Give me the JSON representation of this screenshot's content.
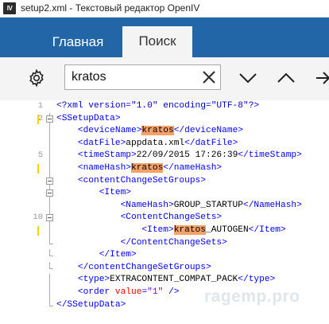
{
  "window": {
    "icon_text": "lV",
    "title": "setup2.xml - Текстовый редактор OpenIV"
  },
  "ribbon": {
    "tabs": [
      {
        "label": "Главная",
        "active": false
      },
      {
        "label": "Поиск",
        "active": true
      }
    ],
    "accent_color": "#2266a8"
  },
  "toolbar": {
    "settings_icon": "gear-icon",
    "search_value": "kratos",
    "clear_icon": "close-icon",
    "find_next_icon": "chevron-down-icon",
    "find_prev_icon": "chevron-up-icon",
    "replace_icon": "arrow-right-icon"
  },
  "editor": {
    "line_number_labels": [
      "1",
      "2",
      "5",
      "10"
    ],
    "lines": [
      {
        "num": "1",
        "fold": "none",
        "mark": false,
        "segments": [
          {
            "text": "<?xml version=\"1.0\" encoding=\"UTF-8\"?>",
            "cls": "t-pi"
          }
        ]
      },
      {
        "num": "2",
        "fold": "box",
        "mark": true,
        "segments": [
          {
            "text": "<SSetupData>",
            "cls": "t-tag"
          }
        ]
      },
      {
        "num": "",
        "fold": "line",
        "mark": false,
        "segments": [
          {
            "text": "    <deviceName>",
            "cls": "t-tag"
          },
          {
            "text": "kratos",
            "cls": "hl"
          },
          {
            "text": "</deviceName>",
            "cls": "t-tag"
          }
        ]
      },
      {
        "num": "",
        "fold": "line",
        "mark": false,
        "segments": [
          {
            "text": "    <datFile>",
            "cls": "t-tag"
          },
          {
            "text": "appdata.xml",
            "cls": "t-txt"
          },
          {
            "text": "</datFile>",
            "cls": "t-tag"
          }
        ]
      },
      {
        "num": "5",
        "fold": "line",
        "mark": false,
        "segments": [
          {
            "text": "    <timeStamp>",
            "cls": "t-tag"
          },
          {
            "text": "22/09/2015 17:26:39",
            "cls": "t-txt"
          },
          {
            "text": "</timeStamp>",
            "cls": "t-tag"
          }
        ]
      },
      {
        "num": "",
        "fold": "line",
        "mark": true,
        "segments": [
          {
            "text": "    <nameHash>",
            "cls": "t-tag"
          },
          {
            "text": "kratos",
            "cls": "hl"
          },
          {
            "text": "</nameHash>",
            "cls": "t-tag"
          }
        ]
      },
      {
        "num": "",
        "fold": "box",
        "mark": false,
        "segments": [
          {
            "text": "    <contentChangeSetGroups>",
            "cls": "t-tag"
          }
        ]
      },
      {
        "num": "",
        "fold": "box",
        "mark": false,
        "segments": [
          {
            "text": "        <Item>",
            "cls": "t-tag"
          }
        ]
      },
      {
        "num": "",
        "fold": "line",
        "mark": false,
        "segments": [
          {
            "text": "            <NameHash>",
            "cls": "t-tag"
          },
          {
            "text": "GROUP_STARTUP",
            "cls": "t-txt"
          },
          {
            "text": "</NameHash>",
            "cls": "t-tag"
          }
        ]
      },
      {
        "num": "10",
        "fold": "box",
        "mark": false,
        "segments": [
          {
            "text": "            <ContentChangeSets>",
            "cls": "t-tag"
          }
        ]
      },
      {
        "num": "",
        "fold": "line",
        "mark": true,
        "segments": [
          {
            "text": "                <Item>",
            "cls": "t-tag"
          },
          {
            "text": "kratos",
            "cls": "hl"
          },
          {
            "text": "_AUTOGEN",
            "cls": "t-txt"
          },
          {
            "text": "</Item>",
            "cls": "t-tag"
          }
        ]
      },
      {
        "num": "",
        "fold": "end",
        "mark": false,
        "segments": [
          {
            "text": "            </ContentChangeSets>",
            "cls": "t-tag"
          }
        ]
      },
      {
        "num": "",
        "fold": "end",
        "mark": false,
        "segments": [
          {
            "text": "        </Item>",
            "cls": "t-tag"
          }
        ]
      },
      {
        "num": "",
        "fold": "end",
        "mark": false,
        "segments": [
          {
            "text": "    </contentChangeSetGroups>",
            "cls": "t-tag"
          }
        ]
      },
      {
        "num": "",
        "fold": "line",
        "mark": false,
        "segments": [
          {
            "text": "    <type>",
            "cls": "t-tag"
          },
          {
            "text": "EXTRACONTENT_COMPAT_PACK",
            "cls": "t-txt"
          },
          {
            "text": "</type>",
            "cls": "t-tag"
          }
        ]
      },
      {
        "num": "",
        "fold": "line",
        "mark": false,
        "segments": [
          {
            "text": "    <order ",
            "cls": "t-tag"
          },
          {
            "text": "value",
            "cls": "t-attr"
          },
          {
            "text": "=",
            "cls": "t-tag"
          },
          {
            "text": "\"1\"",
            "cls": "t-str"
          },
          {
            "text": " />",
            "cls": "t-tag"
          }
        ]
      },
      {
        "num": "",
        "fold": "end",
        "mark": false,
        "segments": [
          {
            "text": "</SSetupData>",
            "cls": "t-tag"
          }
        ]
      }
    ]
  },
  "watermark": "ragemp.pro"
}
